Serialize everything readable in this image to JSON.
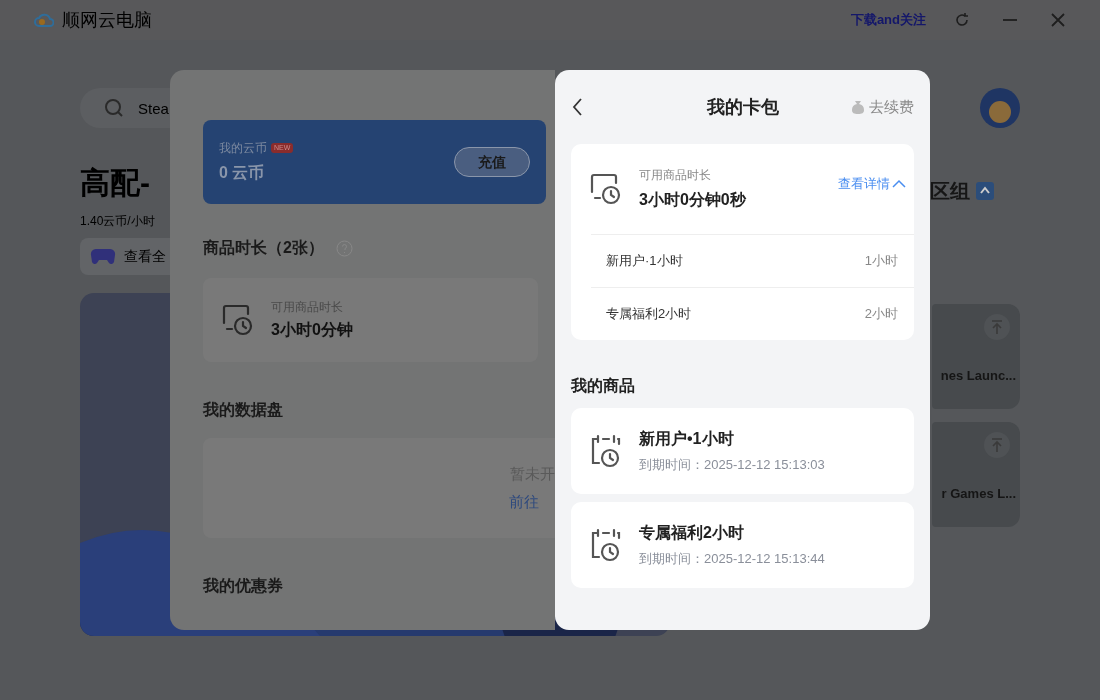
{
  "title_bar": {
    "app_name": "顺网云电脑",
    "link": "下载and关注"
  },
  "background": {
    "search": {
      "placeholder": "Stea"
    },
    "title": "高配-",
    "price": "1.40云币/小时",
    "games_button": "查看全",
    "section_title": "区组",
    "game_cards": [
      {
        "title": "nes Launc..."
      },
      {
        "title": "r Games L..."
      }
    ]
  },
  "modal": {
    "coins": {
      "label": "我的云币",
      "badge": "NEW",
      "amount": "0 云币",
      "button": "充值"
    },
    "duration": {
      "heading": "商品时长（2张）",
      "label": "可用商品时长",
      "value": "3小时0分钟"
    },
    "data_disk": {
      "heading": "我的数据盘",
      "status": "暂未开",
      "link": "前往"
    },
    "coupons": {
      "heading": "我的优惠券"
    }
  },
  "wallet": {
    "title": "我的卡包",
    "renew": "去续费",
    "summary": {
      "label": "可用商品时长",
      "value": "3小时0分钟0秒",
      "details_link": "查看详情",
      "expanded": true,
      "items": [
        {
          "name": "新用户·1小时",
          "duration": "1小时"
        },
        {
          "name": "专属福利2小时",
          "duration": "2小时"
        }
      ]
    },
    "products_heading": "我的商品",
    "products": [
      {
        "name": "新用户•1小时",
        "expiry": "到期时间：2025-12-12 15:13:03"
      },
      {
        "name": "专属福利2小时",
        "expiry": "到期时间：2025-12-12 15:13:44"
      }
    ]
  }
}
